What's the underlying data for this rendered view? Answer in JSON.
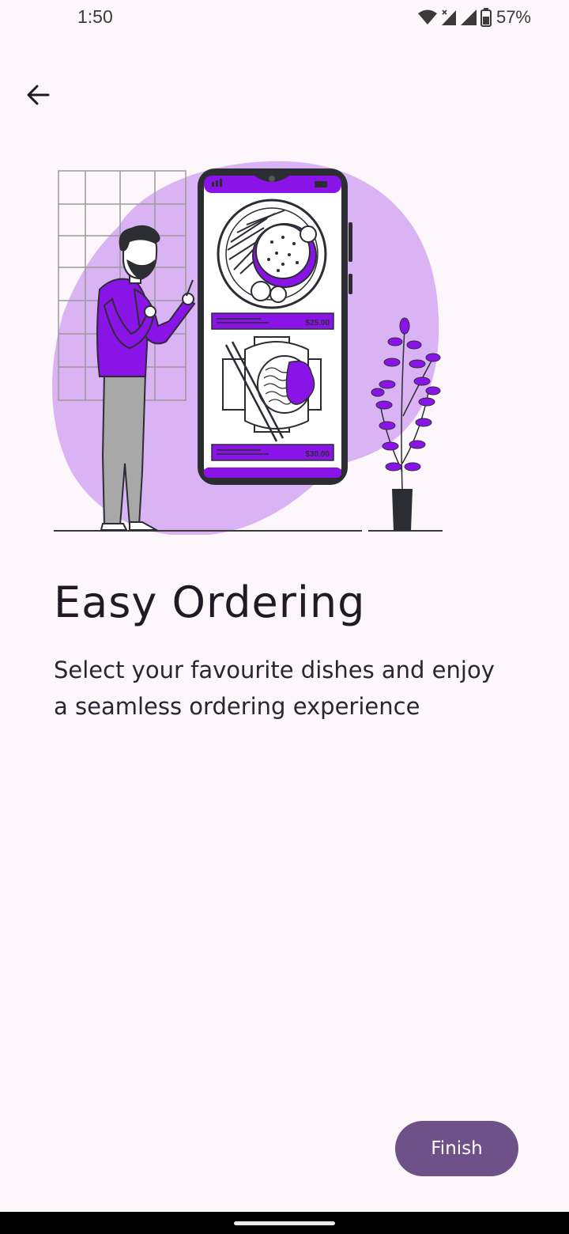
{
  "status_bar": {
    "time": "1:50",
    "battery_percent": "57%",
    "icons": [
      "wifi-icon",
      "signal-icon",
      "signal-icon",
      "battery-icon"
    ]
  },
  "header": {
    "back_icon": "arrow-left-icon"
  },
  "illustration": {
    "subject": "person-ordering-food-on-phone",
    "price_1": "$25.00",
    "price_2": "$30.00"
  },
  "content": {
    "title": "Easy Ordering",
    "description": "Select your favourite dishes and enjoy a seamless ordering experience"
  },
  "actions": {
    "finish_label": "Finish"
  },
  "colors": {
    "background": "#fdf6fb",
    "accent_purple": "#8a14e8",
    "blob_lavender": "#d9b3f3",
    "button": "#6e5189",
    "text": "#1f1a24"
  }
}
